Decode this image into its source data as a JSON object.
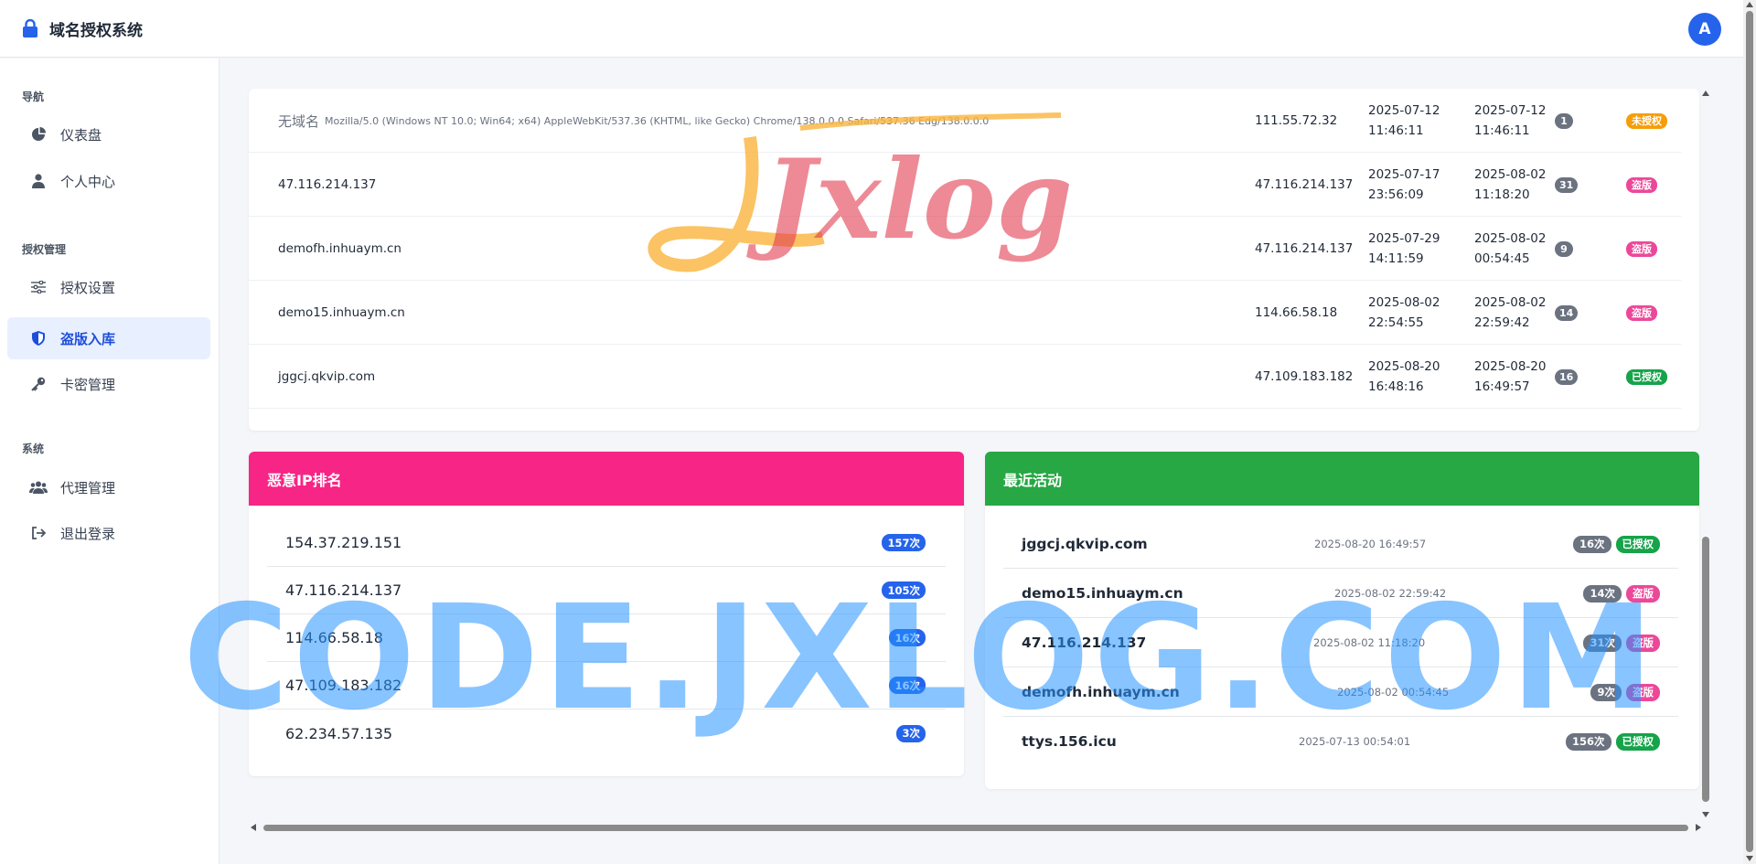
{
  "header": {
    "title": "域名授权系统",
    "avatar_letter": "A"
  },
  "sidebar": {
    "sections": [
      {
        "title": "导航"
      },
      {
        "title": "授权管理"
      },
      {
        "title": "系统"
      }
    ],
    "items": [
      {
        "label": "仪表盘",
        "icon": "pie-chart-icon"
      },
      {
        "label": "个人中心",
        "icon": "user-icon"
      },
      {
        "label": "授权设置",
        "icon": "sliders-icon"
      },
      {
        "label": "盗版入库",
        "icon": "shield-icon",
        "active": true
      },
      {
        "label": "卡密管理",
        "icon": "key-icon"
      },
      {
        "label": "代理管理",
        "icon": "users-icon"
      },
      {
        "label": "退出登录",
        "icon": "logout-icon"
      }
    ]
  },
  "table": {
    "rows": [
      {
        "domain_tag": "无域名",
        "domain": "Mozilla/5.0 (Windows NT 10.0; Win64; x64) AppleWebKit/537.36 (KHTML, like Gecko) Chrome/138.0.0.0 Safari/537.36 Edg/138.0.0.0",
        "ip": "111.55.72.32",
        "first_date": "2025-07-12",
        "first_time": "11:46:11",
        "last_date": "2025-07-12",
        "last_time": "11:46:11",
        "count": "1",
        "status": "未授权",
        "status_color": "#f59e0b"
      },
      {
        "domain": "47.116.214.137",
        "ip": "47.116.214.137",
        "first_date": "2025-07-17",
        "first_time": "23:56:09",
        "last_date": "2025-08-02",
        "last_time": "11:18:20",
        "count": "31",
        "status": "盗版",
        "status_color": "#ec4899"
      },
      {
        "domain": "demofh.inhuaym.cn",
        "ip": "47.116.214.137",
        "first_date": "2025-07-29",
        "first_time": "14:11:59",
        "last_date": "2025-08-02",
        "last_time": "00:54:45",
        "count": "9",
        "status": "盗版",
        "status_color": "#ec4899"
      },
      {
        "domain": "demo15.inhuaym.cn",
        "ip": "114.66.58.18",
        "first_date": "2025-08-02",
        "first_time": "22:54:55",
        "last_date": "2025-08-02",
        "last_time": "22:59:42",
        "count": "14",
        "status": "盗版",
        "status_color": "#ec4899"
      },
      {
        "domain": "jggcj.qkvip.com",
        "ip": "47.109.183.182",
        "first_date": "2025-08-20",
        "first_time": "16:48:16",
        "last_date": "2025-08-20",
        "last_time": "16:49:57",
        "count": "16",
        "status": "已授权",
        "status_color": "#16a34a"
      }
    ]
  },
  "malicious_ip": {
    "title": "恶意IP排名",
    "header_color": "#f72585",
    "rows": [
      {
        "ip": "154.37.219.151",
        "hits": "157次"
      },
      {
        "ip": "47.116.214.137",
        "hits": "105次"
      },
      {
        "ip": "114.66.58.18",
        "hits": "16次"
      },
      {
        "ip": "47.109.183.182",
        "hits": "16次"
      },
      {
        "ip": "62.234.57.135",
        "hits": "3次"
      }
    ]
  },
  "recent_activity": {
    "title": "最近活动",
    "header_color": "#28a745",
    "rows": [
      {
        "domain": "jggcj.qkvip.com",
        "time": "2025-08-20 16:49:57",
        "count": "16次",
        "status": "已授权",
        "status_color": "#16a34a"
      },
      {
        "domain": "demo15.inhuaym.cn",
        "time": "2025-08-02 22:59:42",
        "count": "14次",
        "status": "盗版",
        "status_color": "#ec4899"
      },
      {
        "domain": "47.116.214.137",
        "time": "2025-08-02 11:18:20",
        "count": "31次",
        "status": "盗版",
        "status_color": "#ec4899"
      },
      {
        "domain": "demofh.inhuaym.cn",
        "time": "2025-08-02 00:54:45",
        "count": "9次",
        "status": "盗版",
        "status_color": "#ec4899"
      },
      {
        "domain": "ttys.156.icu",
        "time": "2025-07-13 00:54:01",
        "count": "156次",
        "status": "已授权",
        "status_color": "#16a34a"
      }
    ]
  },
  "watermarks": {
    "text": "CODE.JXLOG.COM",
    "logo_text": "Jxlog"
  }
}
